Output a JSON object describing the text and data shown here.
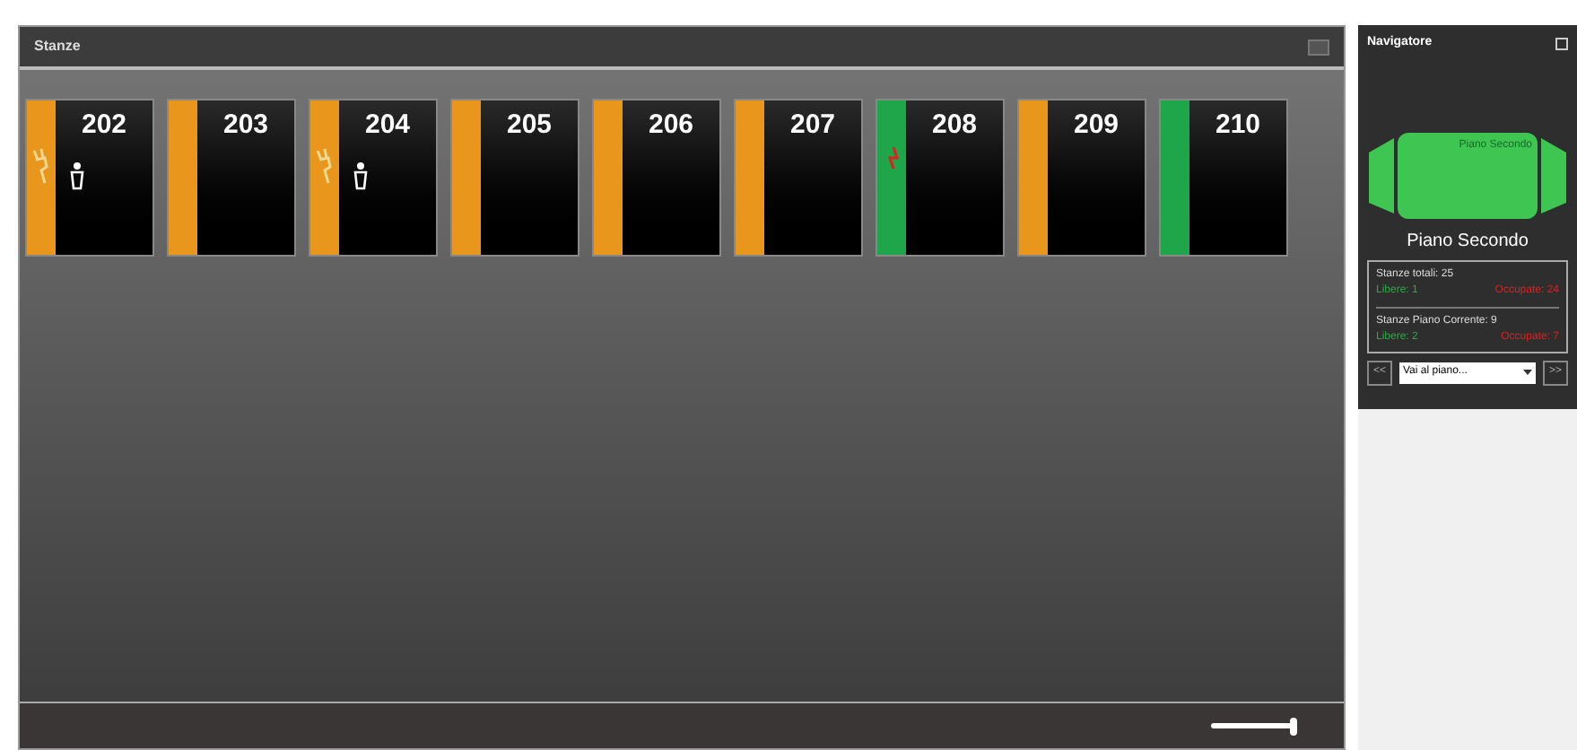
{
  "rooms_panel": {
    "title": "Stanze",
    "rooms": [
      {
        "number": "202",
        "color": "#e8961c",
        "plug": true,
        "guest": true,
        "alert": false
      },
      {
        "number": "203",
        "color": "#e8961c",
        "plug": false,
        "guest": false,
        "alert": false
      },
      {
        "number": "204",
        "color": "#e8961c",
        "plug": true,
        "guest": true,
        "alert": false
      },
      {
        "number": "205",
        "color": "#e8961c",
        "plug": false,
        "guest": false,
        "alert": false
      },
      {
        "number": "206",
        "color": "#e8961c",
        "plug": false,
        "guest": false,
        "alert": false
      },
      {
        "number": "207",
        "color": "#e8961c",
        "plug": false,
        "guest": false,
        "alert": false
      },
      {
        "number": "208",
        "color": "#1fa64a",
        "plug": false,
        "guest": false,
        "alert": true
      },
      {
        "number": "209",
        "color": "#e8961c",
        "plug": false,
        "guest": false,
        "alert": false
      },
      {
        "number": "210",
        "color": "#1fa64a",
        "plug": false,
        "guest": false,
        "alert": false
      }
    ],
    "zoom": {
      "level": 1
    }
  },
  "navigator": {
    "title": "Navigatore",
    "floor_shape_label": "Piano Secondo",
    "floor_name": "Piano Secondo",
    "stats": [
      {
        "label": "Stanze totali: 25",
        "free": "Libere: 1",
        "occupied": "Occupate: 24"
      },
      {
        "label": "Stanze Piano Corrente: 9",
        "free": "Libere: 2",
        "occupied": "Occupate: 7"
      }
    ],
    "prev": "<<",
    "select": {
      "value": "Vai al piano..."
    },
    "next": ">>"
  }
}
